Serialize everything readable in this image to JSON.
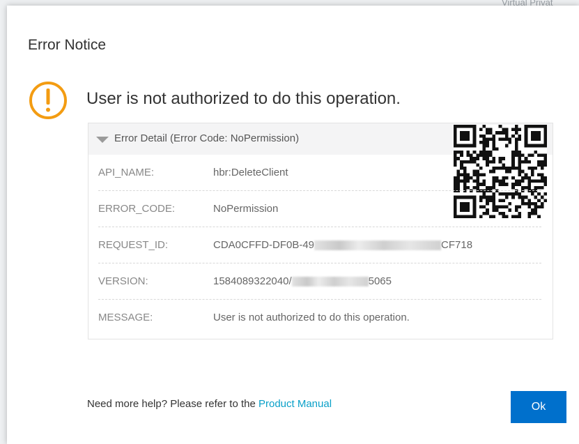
{
  "background": {
    "partial_text": "Virtual Privat"
  },
  "dialog": {
    "title": "Error Notice",
    "message": "User is not authorized to do this operation.",
    "icon": "warning-icon",
    "accent_color": "#f39c12"
  },
  "detail": {
    "header": "Error Detail (Error Code: NoPermission)",
    "rows": [
      {
        "key": "API_NAME:",
        "value": "hbr:DeleteClient"
      },
      {
        "key": "ERROR_CODE:",
        "value": "NoPermission"
      },
      {
        "key": "REQUEST_ID:",
        "value_prefix": "CDA0CFFD-DF0B-49",
        "value_suffix": "CF718"
      },
      {
        "key": "VERSION:",
        "value_prefix": "1584089322040/",
        "value_suffix": "5065"
      },
      {
        "key": "MESSAGE:",
        "value": "User is not authorized to do this operation."
      }
    ]
  },
  "footer": {
    "help_text": "Need more help? Please refer to the ",
    "help_link": "Product Manual",
    "ok_label": "Ok",
    "link_color": "#0aa0c8",
    "button_color": "#0070cc"
  }
}
